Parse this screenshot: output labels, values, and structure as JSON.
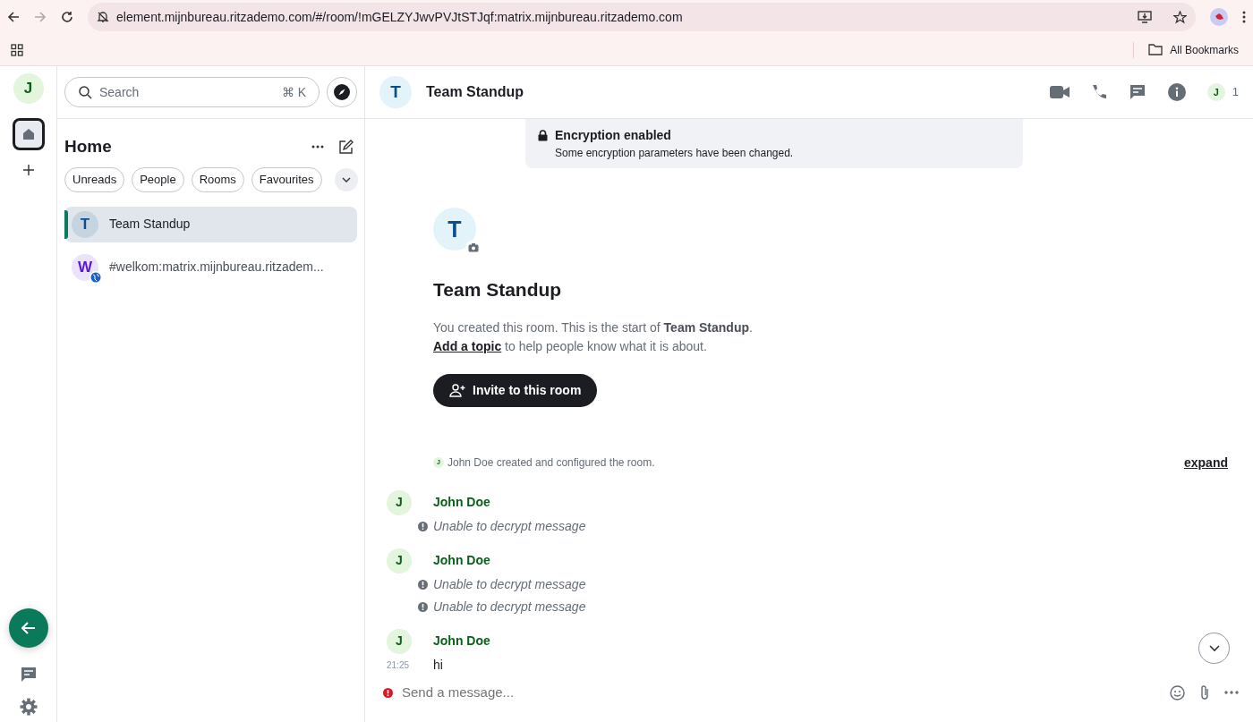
{
  "browser": {
    "url": "element.mijnbureau.ritzademo.com/#/room/!mGELZYJwvPVJtSTJqf:matrix.mijnbureau.ritzademo.com",
    "bookmarks_label": "All Bookmarks"
  },
  "space_bar": {
    "avatar": "J"
  },
  "room_list": {
    "search_placeholder": "Search",
    "shortcut": "⌘ K",
    "title": "Home",
    "filters": [
      {
        "label": "Unreads",
        "selected": false
      },
      {
        "label": "People",
        "selected": false
      },
      {
        "label": "Rooms",
        "selected": false
      },
      {
        "label": "Favourites",
        "selected": false
      }
    ],
    "rooms": [
      {
        "avatar": "T",
        "name": "Team Standup",
        "selected": true,
        "public": false,
        "color": "#0b4f8a"
      },
      {
        "avatar": "W",
        "name": "#welkom:matrix.mijnbureau.ritzadem...",
        "selected": false,
        "public": true,
        "color": "#5b16d6"
      }
    ]
  },
  "room_header": {
    "avatar": "T",
    "name": "Team Standup",
    "member_avatar": "J",
    "member_count": "1"
  },
  "encryption": {
    "title": "Encryption enabled",
    "subtitle": "Some encryption parameters have been changed."
  },
  "room_intro": {
    "avatar": "T",
    "name": "Team Standup",
    "line1": "You created this room. This is the start of **Team Standup**.",
    "topic_link": "Add a topic",
    "line2": " to help people know what it is about.",
    "invite_button": "Invite to this room"
  },
  "summary": {
    "avatar": "J",
    "text": "John Doe created and configured the room.",
    "expand": "expand"
  },
  "messages": [
    {
      "avatar": "J",
      "sender": "John Doe",
      "lines": [
        {
          "kind": "error",
          "text": "Unable to decrypt message"
        }
      ]
    },
    {
      "avatar": "J",
      "sender": "John Doe",
      "lines": [
        {
          "kind": "error",
          "text": "Unable to decrypt message"
        },
        {
          "kind": "error",
          "text": "Unable to decrypt message"
        }
      ]
    },
    {
      "avatar": "J",
      "sender": "John Doe",
      "lines": [
        {
          "kind": "text",
          "text": "hi",
          "time": "21:25"
        }
      ]
    }
  ],
  "composer": {
    "placeholder": "Send a message..."
  }
}
